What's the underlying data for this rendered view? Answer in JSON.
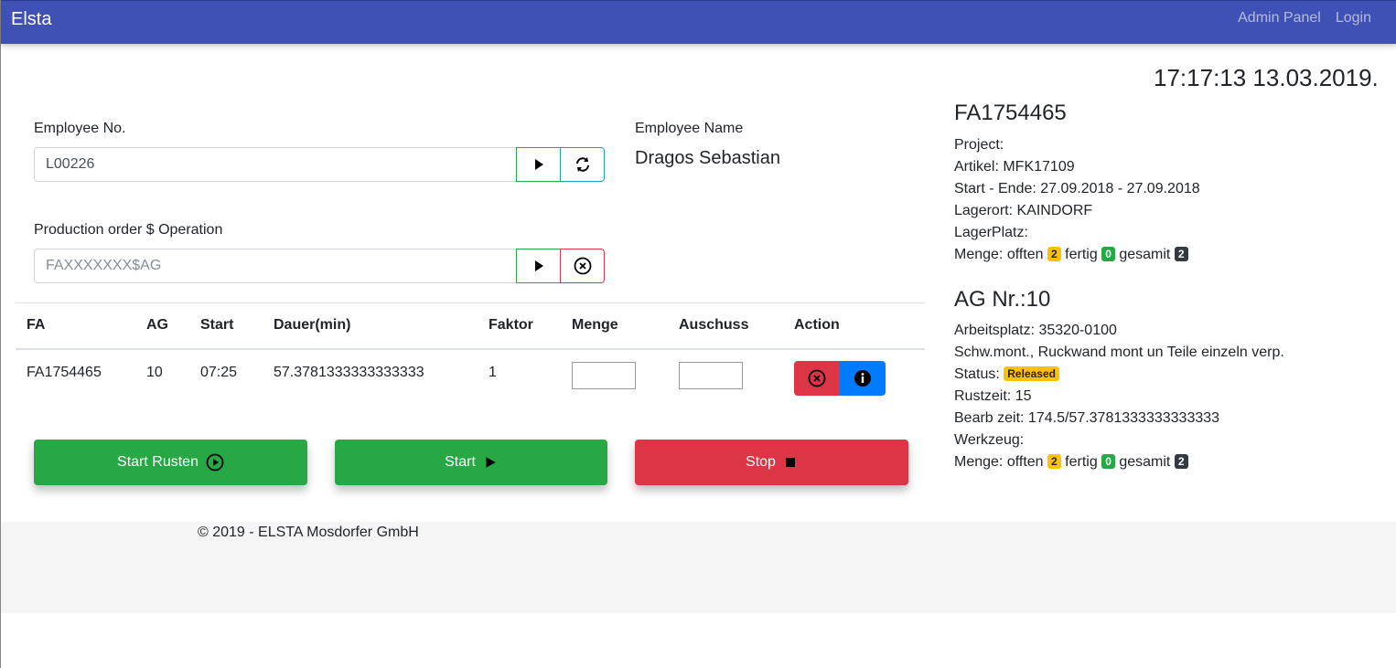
{
  "app": {
    "brand": "Elsta",
    "nav": [
      "Admin Panel",
      "Login"
    ]
  },
  "clock": "17:17:13 13.03.2019.",
  "form": {
    "employee_label": "Employee No.",
    "employee_value": "L00226",
    "employee_name_label": "Employee Name",
    "employee_name": "Dragos Sebastian",
    "order_label": "Production order $ Operation",
    "order_placeholder": "FAXXXXXXX$AG"
  },
  "table": {
    "headers": [
      "FA",
      "AG",
      "Start",
      "Dauer(min)",
      "Faktor",
      "Menge",
      "Auschuss",
      "Action"
    ],
    "rows": [
      {
        "fa": "FA1754465",
        "ag": "10",
        "start": "07:25",
        "dauer": "57.3781333333333333",
        "faktor": "1",
        "menge": "",
        "auschuss": ""
      }
    ]
  },
  "buttons": {
    "start_rusten": "Start Rusten",
    "start": "Start",
    "stop": "Stop"
  },
  "footer": "© 2019 - ELSTA Mosdorfer GmbH",
  "fa_panel": {
    "title": "FA1754465",
    "project": "Project:",
    "artikel": "Artikel: MFK17109",
    "start_ende": "Start - Ende: 27.09.2018 - 27.09.2018",
    "lagerort": "Lagerort: KAINDORF",
    "lagerplatz": "LagerPlatz:",
    "menge_prefix": "Menge: offten",
    "offen": "2",
    "fertig_label": "fertig",
    "fertig": "0",
    "gesamit_label": "gesamit",
    "gesamit": "2"
  },
  "ag_panel": {
    "title": "AG Nr.:10",
    "arbeitsplatz": "Arbeitsplatz: 35320-0100",
    "beschreibung": "Schw.mont., Ruckwand mont un Teile einzeln verp.",
    "status_label": "Status:",
    "status": "Released",
    "rustzeit": "Rustzeit: 15",
    "bearb": "Bearb zeit: 174.5/57.3781333333333333",
    "werkzeug": "Werkzeug:",
    "menge_prefix": "Menge: offten",
    "offen": "2",
    "fertig_label": "fertig",
    "fertig": "0",
    "gesamit_label": "gesamit",
    "gesamit": "2"
  },
  "colors": {
    "navbar": "#3f51b5",
    "success": "#28a745",
    "danger": "#dc3545",
    "primary": "#007bff",
    "warning": "#ffc107"
  }
}
